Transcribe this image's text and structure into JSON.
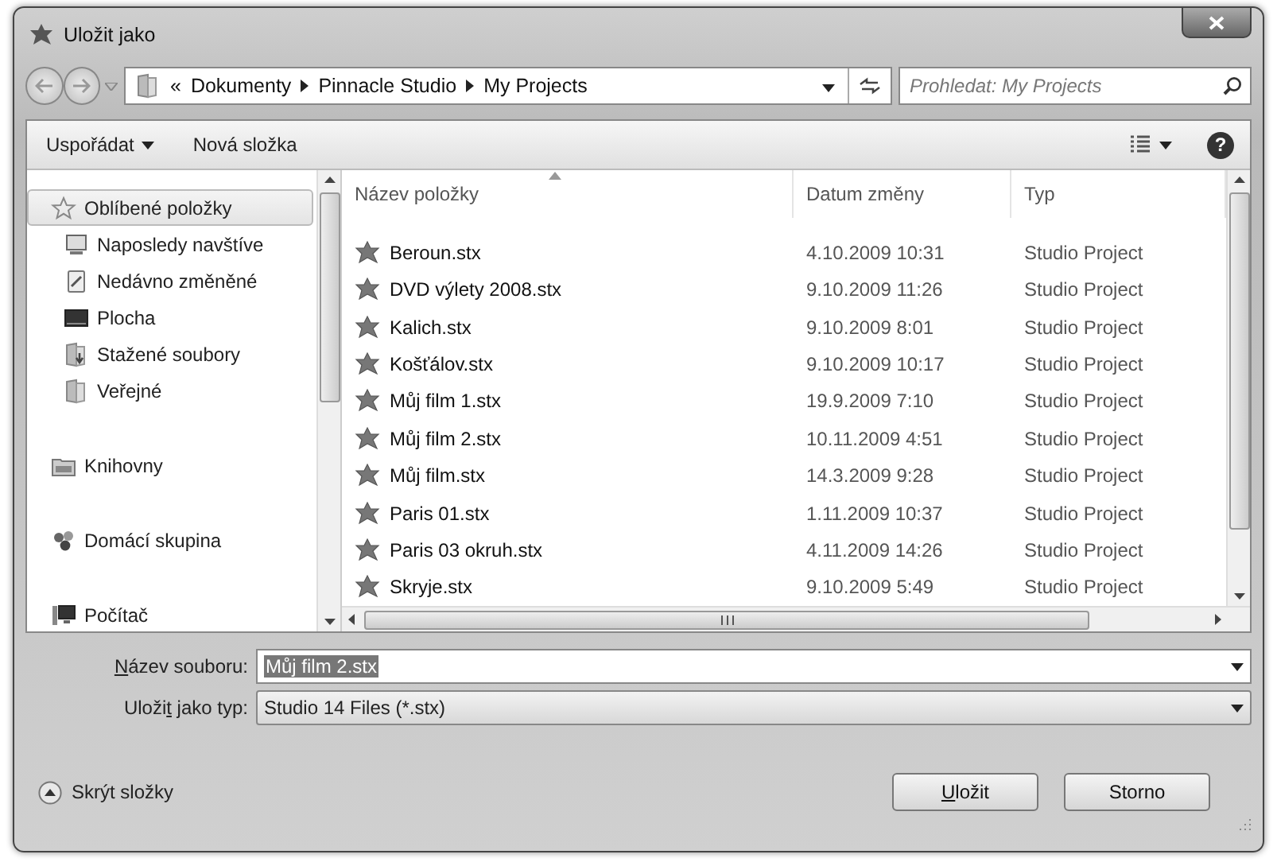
{
  "window": {
    "title": "Uložit jako"
  },
  "address": {
    "crumbs": [
      "«",
      "Dokumenty",
      "Pinnacle Studio",
      "My Projects"
    ]
  },
  "search": {
    "placeholder": "Prohledat: My Projects"
  },
  "toolbar": {
    "organize": "Uspořádat",
    "new_folder": "Nová složka",
    "help": "?"
  },
  "sidebar": {
    "groups": [
      {
        "label": "Oblíbené položky",
        "kind": "star",
        "selected": true,
        "children": [
          {
            "label": "Naposledy navštíve",
            "kind": "recent",
            "selected": false
          },
          {
            "label": "Nedávno změněné",
            "kind": "changed",
            "selected": false
          },
          {
            "label": "Plocha",
            "kind": "desktop",
            "selected": false
          },
          {
            "label": "Stažené soubory",
            "kind": "downloads",
            "selected": false
          },
          {
            "label": "Veřejné",
            "kind": "folder",
            "selected": false
          }
        ]
      },
      {
        "label": "Knihovny",
        "kind": "library",
        "selected": false
      },
      {
        "label": "Domácí skupina",
        "kind": "homegroup",
        "selected": false
      },
      {
        "label": "Počítač",
        "kind": "computer",
        "selected": false
      }
    ]
  },
  "table": {
    "columns": [
      {
        "label": "Název položky",
        "sorted": true
      },
      {
        "label": "Datum změny",
        "sorted": false
      },
      {
        "label": "Typ",
        "sorted": false
      }
    ],
    "rows": [
      {
        "name": "Beroun.stx",
        "date": "4.10.2009 10:31",
        "type": "Studio Project"
      },
      {
        "name": "DVD výlety 2008.stx",
        "date": "9.10.2009 11:26",
        "type": "Studio Project"
      },
      {
        "name": "Kalich.stx",
        "date": "9.10.2009 8:01",
        "type": "Studio Project"
      },
      {
        "name": "Košťálov.stx",
        "date": "9.10.2009 10:17",
        "type": "Studio Project"
      },
      {
        "name": "Můj film 1.stx",
        "date": "19.9.2009 7:10",
        "type": "Studio Project"
      },
      {
        "name": "Můj film 2.stx",
        "date": "10.11.2009 4:51",
        "type": "Studio Project"
      },
      {
        "name": "Můj film.stx",
        "date": "14.3.2009 9:28",
        "type": "Studio Project"
      },
      {
        "name": "Paris 01.stx",
        "date": "1.11.2009 10:37",
        "type": "Studio Project"
      },
      {
        "name": "Paris 03 okruh.stx",
        "date": "4.11.2009 14:26",
        "type": "Studio Project"
      },
      {
        "name": "Skryje.stx",
        "date": "9.10.2009 5:49",
        "type": "Studio Project"
      }
    ]
  },
  "form": [
    {
      "label": [
        {
          "text": "N",
          "underlined": true
        },
        {
          "text": "ázev souboru:",
          "underlined": false
        }
      ],
      "value": "Můj film 2.stx",
      "selected": true,
      "kind": "edit"
    },
    {
      "label": [
        {
          "text": "Uloži",
          "underlined": false
        },
        {
          "text": "t",
          "underlined": true
        },
        {
          "text": " jako typ:",
          "underlined": false
        }
      ],
      "value": "Studio 14 Files (*.stx)",
      "selected": false,
      "kind": "combo"
    }
  ],
  "hide_folders": "Skrýt složky",
  "buttons": [
    {
      "label": [
        {
          "text": "U",
          "underlined": true
        },
        {
          "text": "ložit",
          "underlined": false
        }
      ]
    },
    {
      "label": [
        {
          "text": "Storno",
          "underlined": false
        }
      ]
    }
  ]
}
